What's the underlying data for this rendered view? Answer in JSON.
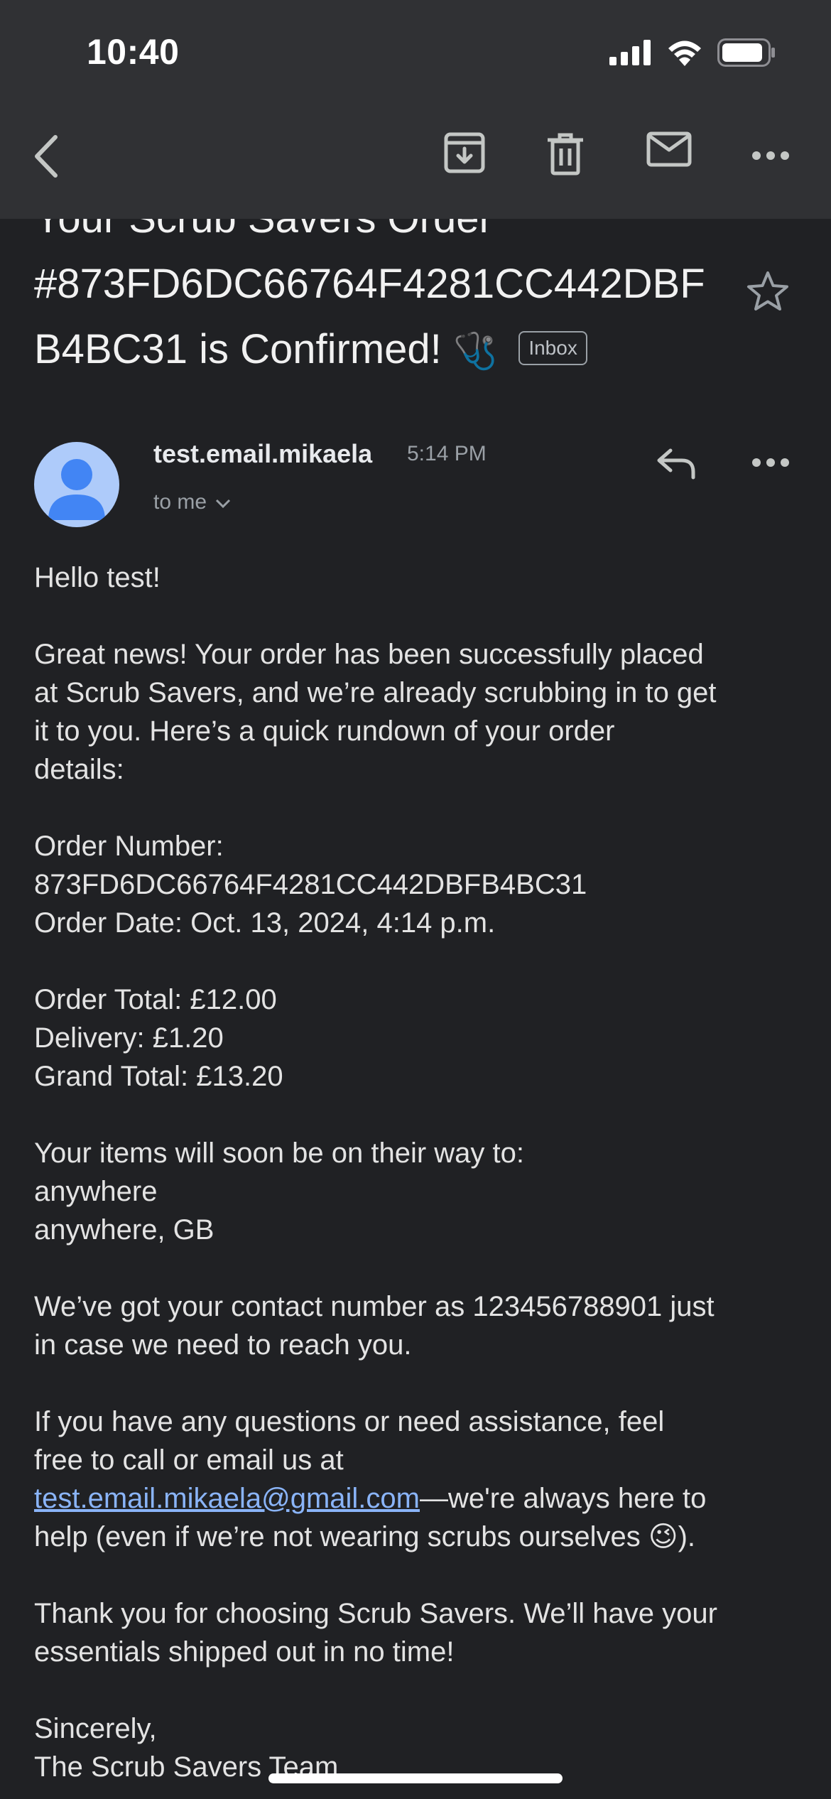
{
  "status_bar": {
    "time": "10:40"
  },
  "toolbar": {
    "back_icon": "chevron-left-icon",
    "archive_icon": "archive-icon",
    "delete_icon": "trash-icon",
    "mark_unread_icon": "mail-icon",
    "more_icon": "more-horizontal-icon"
  },
  "email": {
    "subject_line1": "Your Scrub Savers Order",
    "subject_line2": "#873FD6DC66764F4281CC442DBF",
    "subject_line3": "B4BC31 is Confirmed!",
    "subject_emoji": "🩺",
    "label": "Inbox",
    "sender": "test.email.mikaela",
    "time": "5:14 PM",
    "recipient": "to me",
    "body": {
      "greeting": "Hello test!",
      "intro": [
        "Great news! Your order has been successfully placed",
        "at Scrub Savers, and we’re already scrubbing in to get",
        "it to you. Here’s a quick rundown of your order",
        "details:"
      ],
      "order": [
        "Order Number:",
        "873FD6DC66764F4281CC442DBFB4BC31",
        "Order Date: Oct. 13, 2024, 4:14 p.m."
      ],
      "totals": [
        "Order Total: £12.00",
        "Delivery: £1.20",
        "Grand Total: £13.20"
      ],
      "shipping": [
        "Your items will soon be on their way to:",
        "anywhere",
        "anywhere, GB"
      ],
      "contact": [
        "We’ve got your contact number as 123456788901 just",
        "in case we need to reach you."
      ],
      "help_line1": "If you have any questions or need assistance, feel",
      "help_line2": "free to call or email us at",
      "help_email": "test.email.mikaela@gmail.com",
      "help_line3_after": "—we're always here to",
      "help_line4": "help (even if we’re not wearing scrubs ourselves 😉).",
      "thanks": [
        "Thank you for choosing Scrub Savers. We’ll have your",
        "essentials shipped out in no time!"
      ],
      "signoff": [
        "Sincerely,",
        "The Scrub Savers Team"
      ]
    }
  }
}
